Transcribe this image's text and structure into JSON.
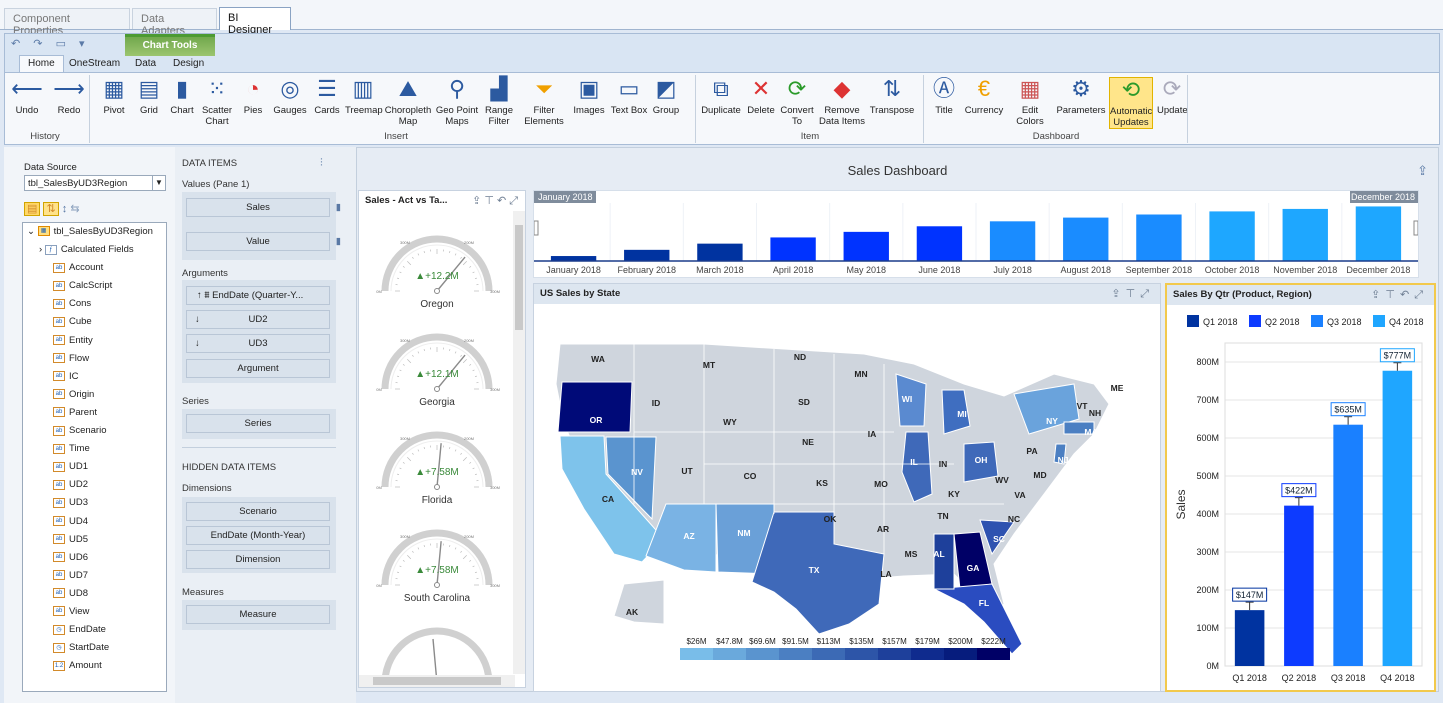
{
  "doc_tabs": [
    "Component Properties",
    "Data Adapters",
    "BI Designer"
  ],
  "ribbon": {
    "context_label": "Chart Tools",
    "tabs": [
      "Home",
      "OneStream",
      "Data",
      "Design"
    ],
    "qat": [
      "↶",
      "↷",
      "▭",
      "▾"
    ],
    "history": [
      {
        "label": "Undo",
        "icon": "undo-icon"
      },
      {
        "label": "Redo",
        "icon": "redo-icon"
      }
    ],
    "history_group": "History",
    "insert": [
      {
        "label": "Pivot",
        "icon": "pivot-icon"
      },
      {
        "label": "Grid",
        "icon": "grid-icon"
      },
      {
        "label": "Chart",
        "icon": "bar-chart-icon"
      },
      {
        "label": "Scatter Chart",
        "icon": "scatter-icon"
      },
      {
        "label": "Pies",
        "icon": "pie-icon"
      },
      {
        "label": "Gauges",
        "icon": "gauge-icon"
      },
      {
        "label": "Cards",
        "icon": "cards-icon"
      },
      {
        "label": "Treemap",
        "icon": "treemap-icon"
      },
      {
        "label": "Choropleth Map",
        "icon": "choropleth-icon"
      },
      {
        "label": "Geo Point Maps",
        "icon": "geo-point-icon"
      },
      {
        "label": "Range Filter",
        "icon": "range-filter-icon"
      },
      {
        "label": "Filter Elements",
        "icon": "filter-icon"
      },
      {
        "label": "Images",
        "icon": "image-icon"
      },
      {
        "label": "Text Box",
        "icon": "textbox-icon"
      },
      {
        "label": "Group",
        "icon": "group-icon"
      }
    ],
    "insert_group": "Insert",
    "item": [
      {
        "label": "Duplicate",
        "icon": "duplicate-icon"
      },
      {
        "label": "Delete",
        "icon": "delete-icon"
      },
      {
        "label": "Convert To",
        "icon": "convert-icon"
      },
      {
        "label": "Remove Data Items",
        "icon": "eraser-icon"
      },
      {
        "label": "Transpose",
        "icon": "transpose-icon"
      }
    ],
    "item_group": "Item",
    "dashboard": [
      {
        "label": "Title",
        "icon": "title-icon"
      },
      {
        "label": "Currency",
        "icon": "currency-icon"
      },
      {
        "label": "Edit Colors",
        "icon": "palette-icon"
      },
      {
        "label": "Parameters",
        "icon": "parameters-icon"
      },
      {
        "label": "Automatic Updates",
        "icon": "auto-update-icon"
      },
      {
        "label": "Update",
        "icon": "update-icon"
      }
    ],
    "dashboard_group": "Dashboard"
  },
  "datasource": {
    "label": "Data Source",
    "selected": "tbl_SalesByUD3Region",
    "root": "tbl_SalesByUD3Region",
    "fields": [
      [
        "f",
        "Calculated Fields"
      ],
      [
        "ab",
        "Account"
      ],
      [
        "ab",
        "CalcScript"
      ],
      [
        "ab",
        "Cons"
      ],
      [
        "ab",
        "Cube"
      ],
      [
        "ab",
        "Entity"
      ],
      [
        "ab",
        "Flow"
      ],
      [
        "ab",
        "IC"
      ],
      [
        "ab",
        "Origin"
      ],
      [
        "ab",
        "Parent"
      ],
      [
        "ab",
        "Scenario"
      ],
      [
        "ab",
        "Time"
      ],
      [
        "ab",
        "UD1"
      ],
      [
        "ab",
        "UD2"
      ],
      [
        "ab",
        "UD3"
      ],
      [
        "ab",
        "UD4"
      ],
      [
        "ab",
        "UD5"
      ],
      [
        "ab",
        "UD6"
      ],
      [
        "ab",
        "UD7"
      ],
      [
        "ab",
        "UD8"
      ],
      [
        "ab",
        "View"
      ],
      [
        "d",
        "EndDate"
      ],
      [
        "d",
        "StartDate"
      ],
      [
        "n",
        "Amount"
      ]
    ]
  },
  "dataitems": {
    "title": "DATA ITEMS",
    "values_label": "Values (Pane 1)",
    "values": [
      "Sales",
      "Value"
    ],
    "arguments_label": "Arguments",
    "arguments": [
      "EndDate (Quarter-Y...",
      "UD2",
      "UD3",
      "Argument"
    ],
    "series_label": "Series",
    "series": "Series",
    "hidden_label": "HIDDEN DATA ITEMS",
    "dimensions_label": "Dimensions",
    "dimensions": [
      "Scenario",
      "EndDate (Month-Year)",
      "Dimension"
    ],
    "measures_label": "Measures",
    "measure": "Measure"
  },
  "dashboard": {
    "title": "Sales Dashboard",
    "gauges": {
      "title": "Sales - Act vs Ta...",
      "items": [
        {
          "name": "Oregon",
          "value": "▲+12.2M",
          "level": 0.72
        },
        {
          "name": "Georgia",
          "value": "▲+12.1M",
          "level": 0.72
        },
        {
          "name": "Florida",
          "value": "▲+7.58M",
          "level": 0.53
        },
        {
          "name": "South Carolina",
          "value": "▲+7.58M",
          "level": 0.53
        }
      ],
      "ticks": [
        "0M",
        "300M",
        "200M",
        "300M"
      ]
    },
    "range": {
      "start": "January 2018",
      "end": "December 2018",
      "months": [
        "January 2018",
        "February 2018",
        "March 2018",
        "April 2018",
        "May 2018",
        "June 2018",
        "July 2018",
        "August 2018",
        "September 2018",
        "October 2018",
        "November 2018",
        "December 2018"
      ],
      "values": [
        0.08,
        0.18,
        0.28,
        0.38,
        0.47,
        0.56,
        0.64,
        0.7,
        0.75,
        0.8,
        0.84,
        0.88
      ],
      "colors": [
        "#0033a0",
        "#0033a0",
        "#0033a0",
        "#0033ff",
        "#0033ff",
        "#0033ff",
        "#1a8cff",
        "#1a8cff",
        "#1a8cff",
        "#1ea7ff",
        "#1ea7ff",
        "#1ea7ff"
      ]
    },
    "map": {
      "title": "US Sales by State",
      "legend": [
        "$26M",
        "$47.8M",
        "$69.6M",
        "$91.5M",
        "$113M",
        "$135M",
        "$157M",
        "$179M",
        "$200M",
        "$222M"
      ],
      "legend_colors": [
        "#79bde9",
        "#6aa9dc",
        "#5a94cf",
        "#4b7fc2",
        "#3c6ab5",
        "#2d55a8",
        "#1e409b",
        "#0f2b8e",
        "#061c7d",
        "#000066"
      ],
      "states": [
        [
          "WA",
          597,
          361
        ],
        [
          "MT",
          708,
          367
        ],
        [
          "ND",
          799,
          359
        ],
        [
          "MN",
          860,
          376
        ],
        [
          "OR",
          595,
          422
        ],
        [
          "ID",
          655,
          405
        ],
        [
          "WY",
          729,
          424
        ],
        [
          "SD",
          803,
          404
        ],
        [
          "WI",
          906,
          401
        ],
        [
          "MI",
          961,
          416
        ],
        [
          "NY",
          1051,
          423
        ],
        [
          "ME",
          1116,
          390
        ],
        [
          "VT",
          1081,
          408
        ],
        [
          "NH",
          1094,
          415
        ],
        [
          "MA",
          1090,
          434
        ],
        [
          "NE",
          807,
          444
        ],
        [
          "IA",
          871,
          436
        ],
        [
          "IL",
          913,
          464
        ],
        [
          "IN",
          942,
          466
        ],
        [
          "OH",
          980,
          462
        ],
        [
          "PA",
          1031,
          453
        ],
        [
          "NJ",
          1062,
          462
        ],
        [
          "NV",
          636,
          474
        ],
        [
          "UT",
          686,
          473
        ],
        [
          "CO",
          749,
          478
        ],
        [
          "KS",
          821,
          485
        ],
        [
          "MO",
          880,
          486
        ],
        [
          "KY",
          953,
          496
        ],
        [
          "WV",
          1001,
          482
        ],
        [
          "MD",
          1039,
          477
        ],
        [
          "VA",
          1019,
          497
        ],
        [
          "CA",
          607,
          501
        ],
        [
          "TN",
          942,
          518
        ],
        [
          "NC",
          1013,
          521
        ],
        [
          "OK",
          829,
          521
        ],
        [
          "AR",
          882,
          531
        ],
        [
          "SC",
          998,
          541
        ],
        [
          "AZ",
          688,
          538
        ],
        [
          "NM",
          743,
          535
        ],
        [
          "MS",
          910,
          556
        ],
        [
          "AL",
          938,
          556
        ],
        [
          "GA",
          972,
          570
        ],
        [
          "TX",
          813,
          572
        ],
        [
          "LA",
          885,
          576
        ],
        [
          "FL",
          983,
          605
        ],
        [
          "AK",
          631,
          614
        ]
      ]
    },
    "bar": {
      "title": "Sales By Qtr (Product, Region)"
    }
  },
  "chart_data": {
    "type": "bar",
    "title": "Sales By Qtr (Product, Region)",
    "categories": [
      "Q1 2018",
      "Q2 2018",
      "Q3 2018",
      "Q4 2018"
    ],
    "series": [
      {
        "name": "Q1 2018",
        "values": [
          147,
          null,
          null,
          null
        ]
      },
      {
        "name": "Q2 2018",
        "values": [
          null,
          422,
          null,
          null
        ]
      },
      {
        "name": "Q3 2018",
        "values": [
          null,
          null,
          635,
          null
        ]
      },
      {
        "name": "Q4 2018",
        "values": [
          null,
          null,
          null,
          777
        ]
      }
    ],
    "labels": [
      "$147M",
      "$422M",
      "$635M",
      "$777M"
    ],
    "colors": [
      "#0033a0",
      "#0d3bff",
      "#1a80ff",
      "#1fa6ff"
    ],
    "ylabel": "Sales",
    "ylim": [
      0,
      850
    ],
    "yticks": [
      "0M",
      "100M",
      "200M",
      "300M",
      "400M",
      "500M",
      "600M",
      "700M",
      "800M"
    ],
    "legend": "top"
  }
}
